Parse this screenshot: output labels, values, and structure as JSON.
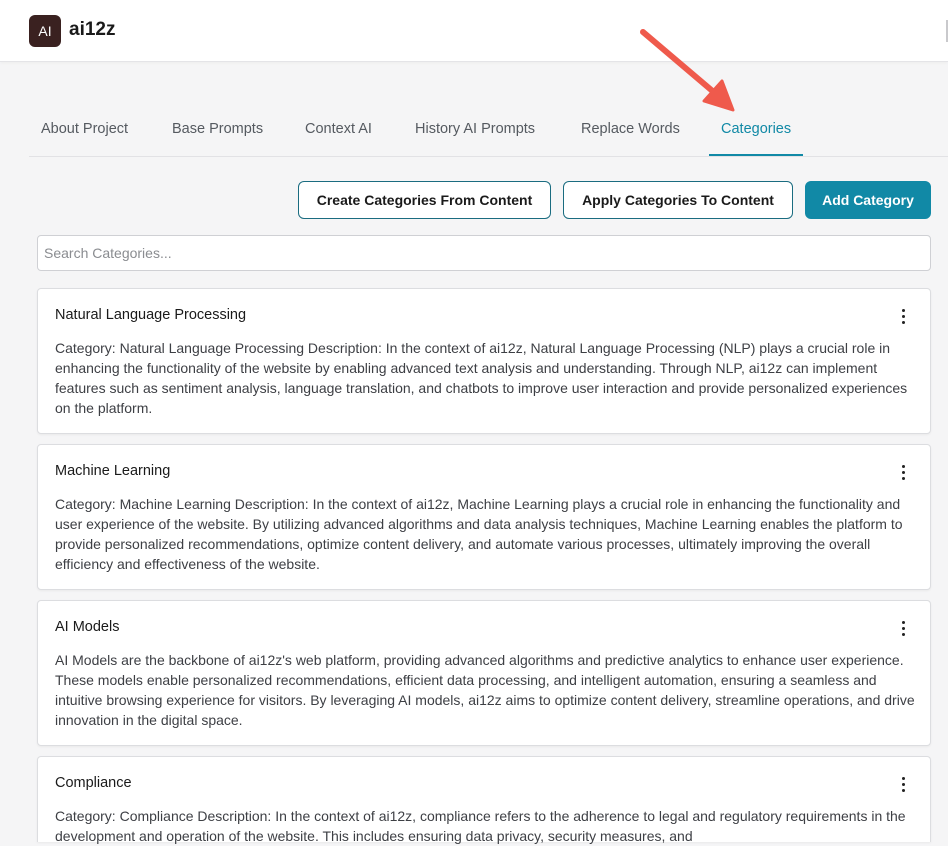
{
  "app": {
    "logo_text": "AI",
    "title": "ai12z"
  },
  "tabs": [
    {
      "label": "About Project",
      "active": false
    },
    {
      "label": "Base Prompts",
      "active": false
    },
    {
      "label": "Context AI",
      "active": false
    },
    {
      "label": "History AI Prompts",
      "active": false
    },
    {
      "label": "Replace Words",
      "active": false
    },
    {
      "label": "Categories",
      "active": true
    }
  ],
  "toolbar": {
    "create_label": "Create Categories From Content",
    "apply_label": "Apply Categories To Content",
    "add_label": "Add Category"
  },
  "search": {
    "placeholder": "Search Categories...",
    "value": ""
  },
  "categories": [
    {
      "title": "Natural Language Processing",
      "description": "Category: Natural Language Processing Description: In the context of ai12z, Natural Language Processing (NLP) plays a crucial role in enhancing the functionality of the website by enabling advanced text analysis and understanding. Through NLP, ai12z can implement features such as sentiment analysis, language translation, and chatbots to improve user interaction and provide personalized experiences on the platform."
    },
    {
      "title": "Machine Learning",
      "description": "Category: Machine Learning Description: In the context of ai12z, Machine Learning plays a crucial role in enhancing the functionality and user experience of the website. By utilizing advanced algorithms and data analysis techniques, Machine Learning enables the platform to provide personalized recommendations, optimize content delivery, and automate various processes, ultimately improving the overall efficiency and effectiveness of the website."
    },
    {
      "title": "AI Models",
      "description": "AI Models are the backbone of ai12z's web platform, providing advanced algorithms and predictive analytics to enhance user experience. These models enable personalized recommendations, efficient data processing, and intelligent automation, ensuring a seamless and intuitive browsing experience for visitors. By leveraging AI models, ai12z aims to optimize content delivery, streamline operations, and drive innovation in the digital space."
    },
    {
      "title": "Compliance",
      "description": "Category: Compliance Description: In the context of ai12z, compliance refers to the adherence to legal and regulatory requirements in the development and operation of the website. This includes ensuring data privacy, security measures, and"
    }
  ],
  "colors": {
    "accent": "#1189a6",
    "logo_bg": "#3a2120",
    "annotation_arrow": "#ef5a4c"
  },
  "icons": {
    "card_menu": "more-vertical-icon",
    "annotation": "pointer-arrow-icon"
  }
}
